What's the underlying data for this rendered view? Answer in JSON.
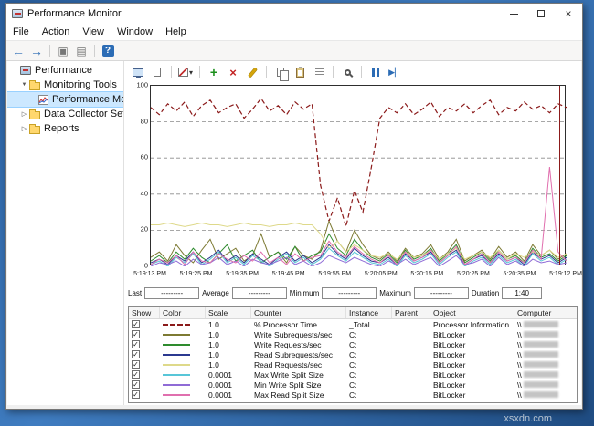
{
  "desktop": {
    "watermark": "xsxdn.com"
  },
  "window": {
    "title": "Performance Monitor",
    "menus": [
      "File",
      "Action",
      "View",
      "Window",
      "Help"
    ]
  },
  "main_toolbar": {
    "items": [
      "back-arrow-icon",
      "forward-arrow-icon",
      "separator",
      "window-icon",
      "list-icon",
      "separator",
      "help-icon"
    ]
  },
  "panel_toolbar": {
    "items": [
      "view-current-icon",
      "view-log-icon",
      "separator",
      "graph-type-dropdown",
      "separator",
      "add-counter-icon",
      "delete-counter-icon",
      "highlight-icon",
      "separator",
      "copy-icon",
      "paste-icon",
      "properties-icon",
      "separator",
      "zoom-icon",
      "separator",
      "freeze-icon",
      "update-icon"
    ]
  },
  "tree": {
    "items": [
      {
        "label": "Performance",
        "level": 0,
        "icon": "console-icon",
        "arrow": "none",
        "selected": false
      },
      {
        "label": "Monitoring Tools",
        "level": 1,
        "icon": "folder-icon",
        "arrow": "expanded",
        "selected": false
      },
      {
        "label": "Performance Monitor",
        "level": 2,
        "icon": "chart-icon",
        "arrow": "none",
        "selected": true
      },
      {
        "label": "Data Collector Sets",
        "level": 1,
        "icon": "folder-icon",
        "arrow": "collapsed",
        "selected": false
      },
      {
        "label": "Reports",
        "level": 1,
        "icon": "folder-icon",
        "arrow": "collapsed",
        "selected": false
      }
    ]
  },
  "stats": {
    "fields": [
      {
        "label": "Last",
        "value": "---------"
      },
      {
        "label": "Average",
        "value": "---------"
      },
      {
        "label": "Minimum",
        "value": "---------"
      },
      {
        "label": "Maximum",
        "value": "---------"
      },
      {
        "label": "Duration",
        "value": "1:40"
      }
    ]
  },
  "legend": {
    "headers": [
      "Show",
      "Color",
      "Scale",
      "Counter",
      "Instance",
      "Parent",
      "Object",
      "Computer"
    ],
    "rows": [
      {
        "show": true,
        "color": "#8b1a1a",
        "dash": true,
        "scale": "1.0",
        "counter": "% Processor Time",
        "instance": "_Total",
        "parent": "",
        "object": "Processor Information",
        "computer": "\\\\"
      },
      {
        "show": true,
        "color": "#7d7a33",
        "dash": false,
        "scale": "1.0",
        "counter": "Write Subrequests/sec",
        "instance": "C:",
        "parent": "",
        "object": "BitLocker",
        "computer": "\\\\"
      },
      {
        "show": true,
        "color": "#2e8b2e",
        "dash": false,
        "scale": "1.0",
        "counter": "Write Requests/sec",
        "instance": "C:",
        "parent": "",
        "object": "BitLocker",
        "computer": "\\\\"
      },
      {
        "show": true,
        "color": "#2b3990",
        "dash": false,
        "scale": "1.0",
        "counter": "Read Subrequests/sec",
        "instance": "C:",
        "parent": "",
        "object": "BitLocker",
        "computer": "\\\\"
      },
      {
        "show": true,
        "color": "#ded98a",
        "dash": false,
        "scale": "1.0",
        "counter": "Read Requests/sec",
        "instance": "C:",
        "parent": "",
        "object": "BitLocker",
        "computer": "\\\\"
      },
      {
        "show": true,
        "color": "#58c6d8",
        "dash": false,
        "scale": "0.0001",
        "counter": "Max Write Split Size",
        "instance": "C:",
        "parent": "",
        "object": "BitLocker",
        "computer": "\\\\"
      },
      {
        "show": true,
        "color": "#8f6bd6",
        "dash": false,
        "scale": "0.0001",
        "counter": "Min Write Split Size",
        "instance": "C:",
        "parent": "",
        "object": "BitLocker",
        "computer": "\\\\"
      },
      {
        "show": true,
        "color": "#e06fae",
        "dash": false,
        "scale": "0.0001",
        "counter": "Max Read Split Size",
        "instance": "C:",
        "parent": "",
        "object": "BitLocker",
        "computer": "\\\\"
      }
    ]
  },
  "chart_data": {
    "type": "line",
    "ylim": [
      0,
      100
    ],
    "yticks": [
      100,
      80,
      60,
      40,
      20,
      0
    ],
    "grid_values": [
      20,
      40,
      60,
      80
    ],
    "xticklabels": [
      "5:19:13 PM",
      "5:19:25 PM",
      "5:19:35 PM",
      "5:19:45 PM",
      "5:19:55 PM",
      "5:20:05 PM",
      "5:20:15 PM",
      "5:20:25 PM",
      "5:20:35 PM",
      "5:19:12 PM"
    ],
    "duration": "1:40",
    "series": [
      {
        "name": "% Processor Time",
        "color": "#8b1a1a",
        "dash": true,
        "values": [
          88,
          84,
          90,
          86,
          91,
          83,
          89,
          92,
          85,
          88,
          90,
          82,
          87,
          93,
          86,
          89,
          84,
          91,
          87,
          90,
          45,
          25,
          38,
          22,
          42,
          30,
          55,
          82,
          88,
          85,
          90,
          84,
          87,
          91,
          83,
          88,
          86,
          90,
          85,
          89,
          92,
          84,
          88,
          86,
          91,
          87,
          89,
          85,
          90,
          88
        ]
      },
      {
        "name": "Write Subrequests/sec",
        "color": "#7d7a33",
        "dash": false,
        "values": [
          5,
          8,
          3,
          12,
          6,
          2,
          9,
          15,
          4,
          7,
          10,
          3,
          6,
          18,
          5,
          8,
          2,
          11,
          6,
          4,
          9,
          25,
          14,
          8,
          20,
          12,
          6,
          4,
          8,
          3,
          10,
          5,
          7,
          12,
          4,
          8,
          15,
          3,
          6,
          9,
          4,
          11,
          5,
          8,
          3,
          12,
          6,
          9,
          4,
          7
        ]
      },
      {
        "name": "Write Requests/sec",
        "color": "#2e8b2e",
        "dash": false,
        "values": [
          3,
          6,
          2,
          8,
          4,
          10,
          5,
          2,
          7,
          12,
          3,
          6,
          9,
          2,
          5,
          8,
          4,
          11,
          3,
          6,
          8,
          18,
          10,
          6,
          15,
          9,
          5,
          3,
          7,
          2,
          9,
          4,
          6,
          10,
          3,
          7,
          12,
          2,
          5,
          8,
          3,
          9,
          4,
          6,
          2,
          10,
          5,
          7,
          3,
          6
        ]
      },
      {
        "name": "Read Subrequests/sec",
        "color": "#2b3990",
        "dash": false,
        "values": [
          2,
          4,
          1,
          6,
          3,
          8,
          2,
          5,
          9,
          3,
          6,
          2,
          7,
          4,
          1,
          5,
          8,
          3,
          6,
          2,
          5,
          12,
          7,
          4,
          10,
          6,
          3,
          2,
          5,
          1,
          7,
          3,
          5,
          8,
          2,
          6,
          9,
          1,
          4,
          6,
          2,
          7,
          3,
          5,
          1,
          8,
          4,
          6,
          2,
          5
        ]
      },
      {
        "name": "Read Requests/sec",
        "color": "#ded98a",
        "dash": false,
        "values": [
          23,
          23,
          24,
          23,
          22,
          23,
          24,
          23,
          23,
          22,
          23,
          24,
          23,
          23,
          22,
          23,
          23,
          24,
          23,
          23,
          18,
          10,
          14,
          8,
          12,
          9,
          6,
          5,
          7,
          4,
          8,
          5,
          6,
          9,
          4,
          7,
          10,
          4,
          6,
          8,
          5,
          9,
          4,
          7,
          5,
          8,
          6,
          9,
          5,
          7
        ]
      },
      {
        "name": "Max Write Split Size",
        "color": "#58c6d8",
        "dash": false,
        "values": [
          1,
          3,
          0,
          5,
          2,
          7,
          1,
          4,
          8,
          2,
          5,
          1,
          6,
          3,
          0,
          4,
          7,
          2,
          5,
          1,
          4,
          10,
          6,
          3,
          8,
          5,
          2,
          1,
          4,
          0,
          6,
          2,
          4,
          7,
          1,
          5,
          8,
          0,
          3,
          5,
          1,
          6,
          2,
          4,
          0,
          7,
          3,
          5,
          1,
          4
        ]
      },
      {
        "name": "Min Write Split Size",
        "color": "#8f6bd6",
        "dash": false,
        "values": [
          0,
          2,
          1,
          3,
          0,
          4,
          1,
          2,
          5,
          1,
          3,
          0,
          4,
          2,
          1,
          3,
          5,
          1,
          3,
          0,
          2,
          6,
          4,
          2,
          5,
          3,
          1,
          0,
          3,
          1,
          4,
          1,
          3,
          5,
          0,
          3,
          6,
          1,
          2,
          4,
          0,
          5,
          1,
          3,
          0,
          4,
          2,
          3,
          1,
          2
        ]
      },
      {
        "name": "Max Read Split Size",
        "color": "#e06fae",
        "dash": false,
        "values": [
          1,
          4,
          2,
          6,
          1,
          8,
          3,
          2,
          7,
          4,
          2,
          6,
          3,
          8,
          2,
          5,
          1,
          7,
          3,
          5,
          6,
          14,
          8,
          5,
          11,
          7,
          4,
          2,
          6,
          1,
          8,
          3,
          5,
          9,
          2,
          6,
          11,
          1,
          4,
          7,
          2,
          8,
          3,
          5,
          2,
          9,
          4,
          55,
          8,
          3
        ]
      }
    ]
  }
}
